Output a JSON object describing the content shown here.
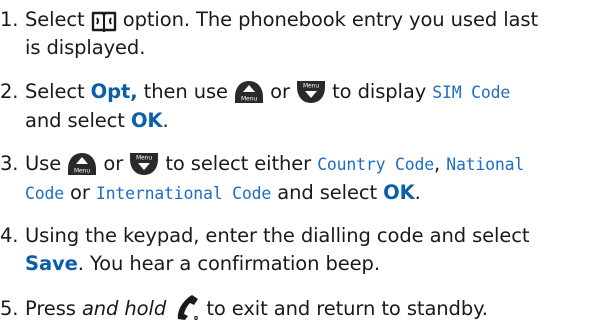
{
  "steps": [
    {
      "num": "1.",
      "a": "Select",
      "b": "option. The phonebook entry you used last",
      "c": "is displayed.",
      "icon": "phonebook-icon"
    },
    {
      "num": "2.",
      "a": "Select",
      "opt": "Opt,",
      "b": "then use",
      "or": "or",
      "c": "to display",
      "lcd": "SIM Code",
      "d": "and select",
      "ok": "OK",
      "dot": ".",
      "icons": [
        "up-menu-button-icon",
        "down-menu-button-icon"
      ]
    },
    {
      "num": "3.",
      "a": "Use",
      "or": "or",
      "b": "to select either",
      "lcd1": "Country Code",
      "comma": ",",
      "lcd2a": "National",
      "lcd2b": "Code",
      "or2": "or",
      "lcd3": "International Code",
      "c": "and select",
      "ok": "OK",
      "dot": ".",
      "up_icon_label": "Menu",
      "down_icon_label": "Menu"
    },
    {
      "num": "4.",
      "a": "Using the keypad, enter the dialling code and select",
      "save": "Save",
      "b": ". You hear a confirmation beep."
    },
    {
      "num": "5.",
      "a": "Press",
      "ital": "and hold",
      "b": "to exit and return to standby.",
      "icon": "end-call-icon"
    }
  ],
  "colors": {
    "text": "#1a1a1a",
    "accent_blue": "#0b5fa8",
    "lcd_blue": "#1f6ec4",
    "button_dark": "#2a2a2a"
  }
}
